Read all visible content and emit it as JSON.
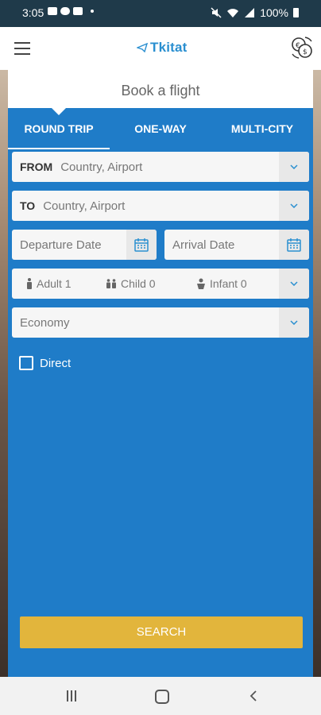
{
  "status_bar": {
    "time": "3:05",
    "battery": "100%",
    "icons": [
      "photo-icon",
      "cloud-icon",
      "youtube-icon",
      "mute-icon",
      "wifi-icon",
      "signal-icon",
      "battery-icon"
    ]
  },
  "app_bar": {
    "logo_text": "Tkitat",
    "menu_icon": "hamburger-menu-icon",
    "currency_icon": "currency-exchange-icon"
  },
  "card": {
    "title": "Book a flight",
    "tabs": [
      {
        "label": "ROUND TRIP",
        "active": true
      },
      {
        "label": "ONE-WAY",
        "active": false
      },
      {
        "label": "MULTI-CITY",
        "active": false
      }
    ],
    "from": {
      "label": "FROM",
      "placeholder": "Country, Airport"
    },
    "to": {
      "label": "TO",
      "placeholder": "Country, Airport"
    },
    "departure_date": {
      "placeholder": "Departure Date"
    },
    "arrival_date": {
      "placeholder": "Arrival Date"
    },
    "passengers": {
      "adult": "Adult 1",
      "child": "Child 0",
      "infant": "Infant 0"
    },
    "cabin_class": {
      "value": "Economy"
    },
    "direct": {
      "label": "Direct",
      "checked": false
    },
    "search_button": "SEARCH"
  },
  "colors": {
    "primary": "#1f7cc8",
    "accent": "#e2b53c",
    "logo": "#2a8fd0",
    "status_bar": "#1f3a4a"
  }
}
